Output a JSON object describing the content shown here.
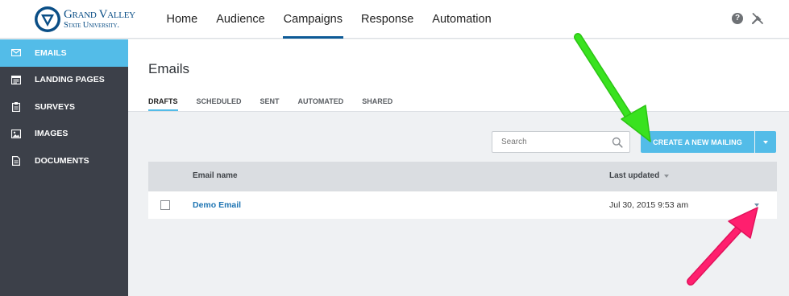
{
  "logo": {
    "line1": "Grand Valley",
    "line2": "State University.",
    "icon": "gvsu-logo-mark"
  },
  "nav": {
    "items": [
      {
        "label": "Home"
      },
      {
        "label": "Audience"
      },
      {
        "label": "Campaigns",
        "active": true
      },
      {
        "label": "Response"
      },
      {
        "label": "Automation"
      }
    ],
    "help_icon": "question-circle-icon",
    "help_glyph": "?",
    "tools_icon": "tools-icon"
  },
  "sidebar": {
    "items": [
      {
        "label": "EMAILS",
        "icon": "envelope-icon",
        "active": true
      },
      {
        "label": "LANDING PAGES",
        "icon": "landing-page-icon"
      },
      {
        "label": "SURVEYS",
        "icon": "clipboard-icon"
      },
      {
        "label": "IMAGES",
        "icon": "image-icon"
      },
      {
        "label": "DOCUMENTS",
        "icon": "document-icon"
      }
    ]
  },
  "main": {
    "title": "Emails",
    "tabs": [
      {
        "label": "DRAFTS",
        "active": true
      },
      {
        "label": "SCHEDULED"
      },
      {
        "label": "SENT"
      },
      {
        "label": "AUTOMATED"
      },
      {
        "label": "SHARED"
      }
    ],
    "search": {
      "placeholder": "Search",
      "value": "",
      "icon": "search-icon"
    },
    "create_button": {
      "label": "CREATE A NEW MAILING",
      "caret_icon": "chevron-down-icon"
    },
    "table": {
      "columns": [
        "Email name",
        "Last updated"
      ],
      "sort_icon": "sort-down-icon",
      "rows": [
        {
          "name": "Demo Email",
          "last_updated": "Jul 30, 2015 9:53 am",
          "checked": false
        }
      ]
    }
  },
  "annotations": {
    "green_arrow_color": "#39e21f",
    "pink_arrow_color": "#ff1f6e"
  },
  "colors": {
    "accent": "#53bce8",
    "sidebar_bg": "#3c4049",
    "link": "#1f75b3",
    "nav_active_underline": "#0d5a96"
  }
}
